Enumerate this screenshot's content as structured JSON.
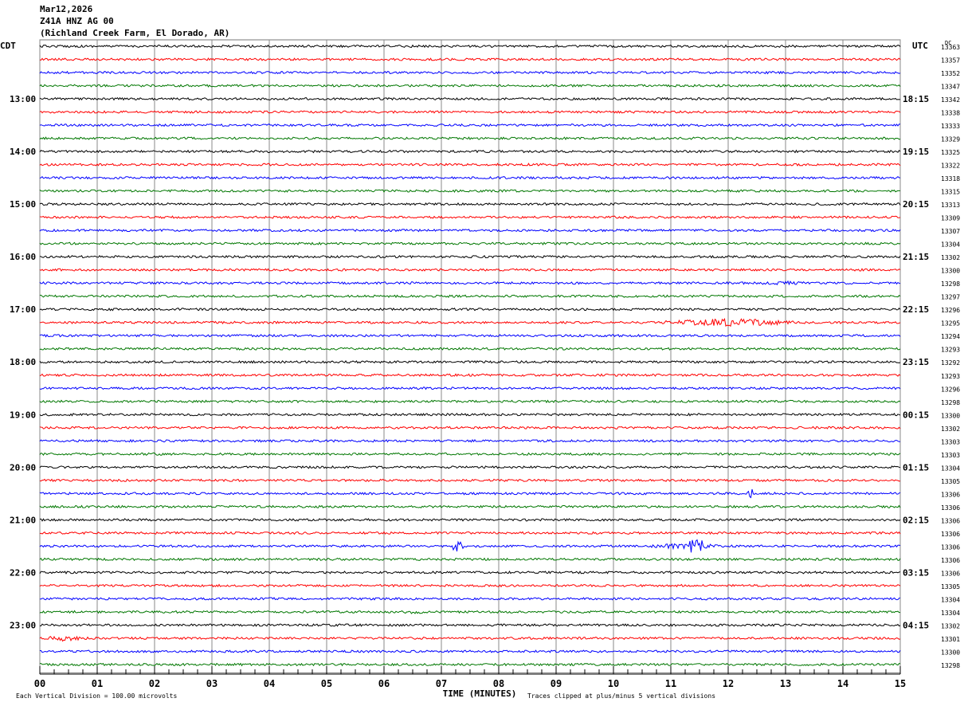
{
  "header": {
    "date": "Mar12,2026",
    "station": "Z41A HNZ AG 00",
    "location": "(Richland Creek Farm, El Dorado, AR)"
  },
  "chart_data": {
    "type": "line",
    "title": "Z41A HNZ AG 00 helicorder",
    "xlabel": "TIME (MINUTES)",
    "xlim": [
      0,
      15
    ],
    "x_ticks": [
      "00",
      "01",
      "02",
      "03",
      "04",
      "05",
      "06",
      "07",
      "08",
      "09",
      "10",
      "11",
      "12",
      "13",
      "14",
      "15"
    ],
    "left_zone": "CDT",
    "right_zone": "UTC",
    "dc_header": "DC",
    "left_hours": [
      "13:00",
      "14:00",
      "15:00",
      "16:00",
      "17:00",
      "18:00",
      "19:00",
      "20:00",
      "21:00",
      "22:00",
      "23:00"
    ],
    "right_hours": [
      "18:15",
      "19:15",
      "20:15",
      "21:15",
      "22:15",
      "23:15",
      "00:15",
      "01:15",
      "02:15",
      "03:15",
      "04:15"
    ],
    "dc_values": [
      "13363",
      "13357",
      "13352",
      "13347",
      "13342",
      "13338",
      "13333",
      "13329",
      "13325",
      "13322",
      "13318",
      "13315",
      "13313",
      "13309",
      "13307",
      "13304",
      "13302",
      "13300",
      "13298",
      "13297",
      "13296",
      "13295",
      "13294",
      "13293",
      "13292",
      "13293",
      "13296",
      "13298",
      "13300",
      "13302",
      "13303",
      "13303",
      "13304",
      "13305",
      "13306",
      "13306",
      "13306",
      "13306",
      "13306",
      "13306",
      "13306",
      "13305",
      "13304",
      "13304",
      "13302",
      "13301",
      "13300",
      "13298"
    ],
    "trace_colors": [
      "#000000",
      "#ff0000",
      "#0000ff",
      "#007700"
    ],
    "events": [
      {
        "trace": 18,
        "start": 12.3,
        "end": 13.6,
        "amp": 2.5
      },
      {
        "trace": 21,
        "start": 10.8,
        "end": 13.2,
        "amp": 5
      },
      {
        "trace": 34,
        "start": 12.35,
        "end": 12.45,
        "amp": 7
      },
      {
        "trace": 38,
        "start": 7.15,
        "end": 7.4,
        "amp": 9
      },
      {
        "trace": 38,
        "start": 10.6,
        "end": 12.0,
        "amp": 4
      },
      {
        "trace": 38,
        "start": 11.3,
        "end": 11.6,
        "amp": 14
      },
      {
        "trace": 43,
        "start": 6.2,
        "end": 6.8,
        "amp": 2.5
      },
      {
        "trace": 45,
        "start": 0.1,
        "end": 0.8,
        "amp": 4
      }
    ],
    "footer_scale": "Each Vertical Division =  100.00 microvolts",
    "footer_clip": "Traces clipped at plus/minus 5 vertical divisions"
  }
}
